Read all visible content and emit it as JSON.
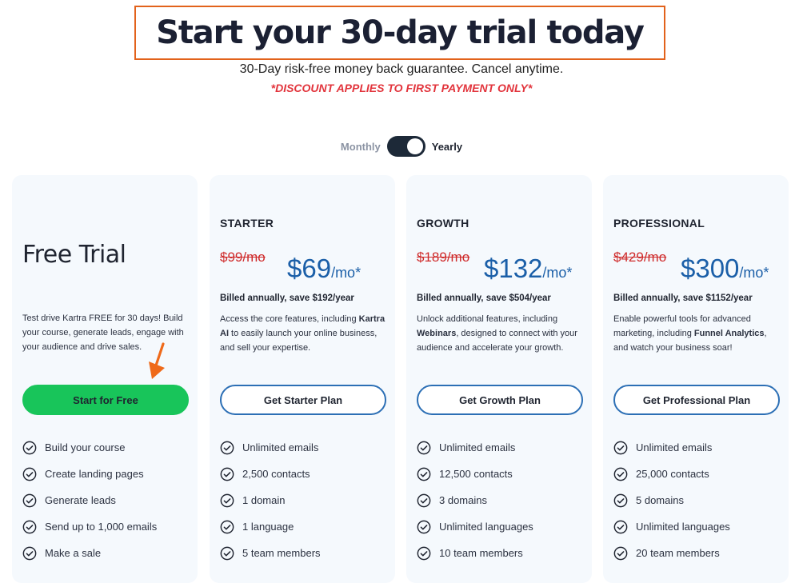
{
  "header": {
    "title": "Start your 30-day trial today",
    "subtitle": "30-Day risk-free money back guarantee. Cancel anytime.",
    "discount": "*DISCOUNT APPLIES TO FIRST PAYMENT ONLY*"
  },
  "billing_toggle": {
    "monthly_label": "Monthly",
    "yearly_label": "Yearly",
    "selected": "Yearly"
  },
  "colors": {
    "accent_blue": "#1b5fa8",
    "cta_green": "#18c55a",
    "strike_red": "#cf2a2a",
    "highlight_orange": "#e2621b"
  },
  "plans": [
    {
      "title": "Free Trial",
      "description": "Test drive Kartra FREE for 30 days! Build your course, generate leads, engage with your audience and drive sales.",
      "cta": "Start for Free",
      "features": [
        "Build your course",
        "Create landing pages",
        "Generate leads",
        "Send up to 1,000 emails",
        "Make a sale"
      ]
    },
    {
      "name": "STARTER",
      "old_price": "$99/mo",
      "price": "$69",
      "per": "/mo*",
      "billed": "Billed annually, save $192/year",
      "desc_before": "Access the core features, including ",
      "desc_bold": "Kartra AI",
      "desc_after": " to easily launch your online business, and sell your expertise.",
      "cta": "Get Starter Plan",
      "features": [
        "Unlimited emails",
        "2,500 contacts",
        "1 domain",
        "1 language",
        "5 team members"
      ]
    },
    {
      "name": "GROWTH",
      "old_price": "$189/mo",
      "price": "$132",
      "per": "/mo*",
      "billed": "Billed annually, save $504/year",
      "desc_before": "Unlock additional features, including ",
      "desc_bold": "Webinars",
      "desc_after": ", designed to connect with your audience and accelerate your growth.",
      "cta": "Get Growth Plan",
      "features": [
        "Unlimited emails",
        "12,500 contacts",
        "3 domains",
        "Unlimited languages",
        "10 team members"
      ]
    },
    {
      "name": "PROFESSIONAL",
      "old_price": "$429/mo",
      "price": "$300",
      "per": "/mo*",
      "billed": "Billed annually, save $1152/year",
      "desc_before": "Enable powerful tools for advanced marketing, including ",
      "desc_bold": "Funnel Analytics",
      "desc_after": ", and watch your business soar!",
      "cta": "Get Professional Plan",
      "features": [
        "Unlimited emails",
        "25,000 contacts",
        "5 domains",
        "Unlimited languages",
        "20 team members"
      ]
    }
  ]
}
